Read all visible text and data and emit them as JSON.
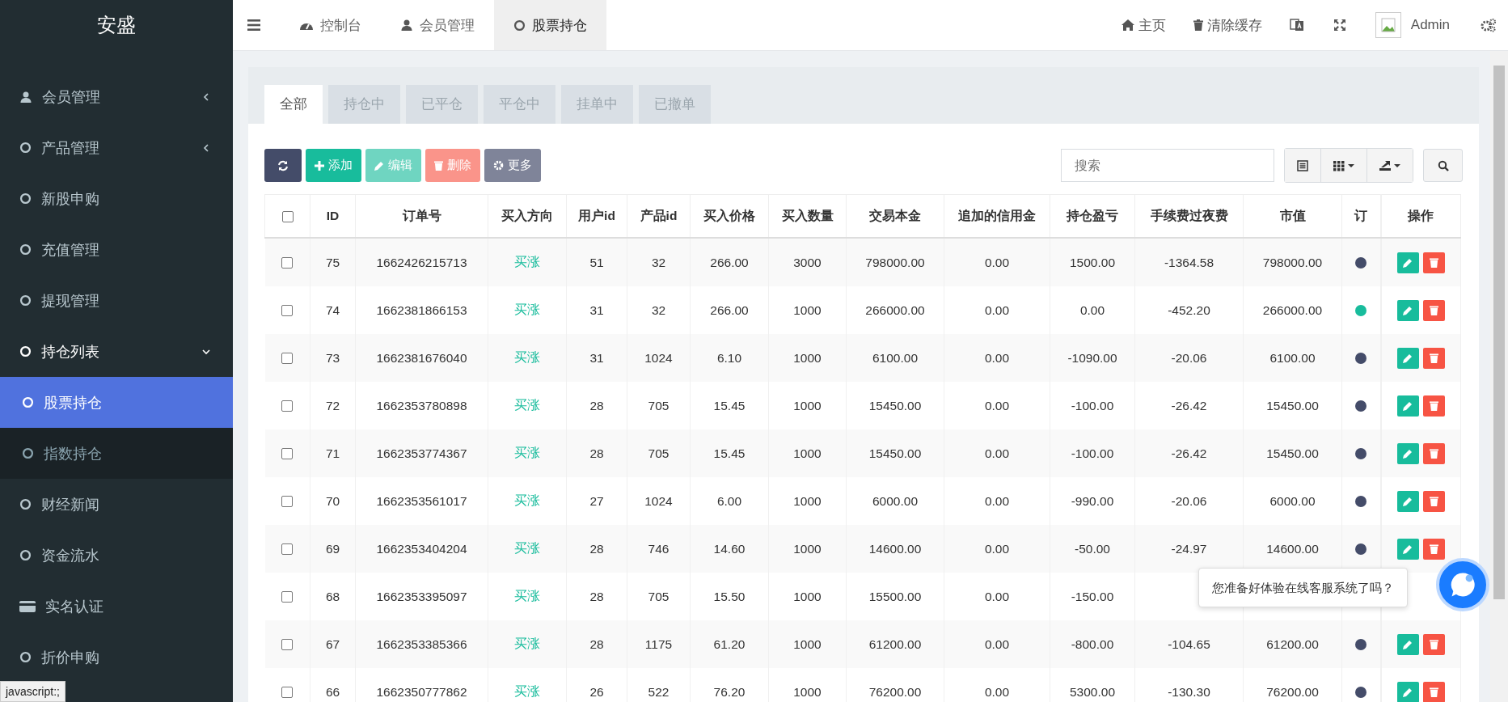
{
  "brand": "安盛",
  "sidebar": {
    "items": [
      {
        "label": "会员管理",
        "kind": "user",
        "expandable": true,
        "expanded": false,
        "selected": false
      },
      {
        "label": "产品管理",
        "kind": "circle",
        "expandable": true,
        "expanded": false,
        "selected": false
      },
      {
        "label": "新股申购",
        "kind": "circle",
        "expandable": false,
        "expanded": false,
        "selected": false
      },
      {
        "label": "充值管理",
        "kind": "circle",
        "expandable": false,
        "expanded": false,
        "selected": false
      },
      {
        "label": "提现管理",
        "kind": "circle",
        "expandable": false,
        "expanded": false,
        "selected": false
      },
      {
        "label": "持仓列表",
        "kind": "circle",
        "expandable": true,
        "expanded": true,
        "selected": false,
        "children": [
          {
            "label": "股票持仓",
            "kind": "circle",
            "selected": true
          },
          {
            "label": "指数持仓",
            "kind": "circle",
            "selected": false
          }
        ]
      },
      {
        "label": "财经新闻",
        "kind": "circle",
        "expandable": false,
        "expanded": false,
        "selected": false
      },
      {
        "label": "资金流水",
        "kind": "circle",
        "expandable": false,
        "expanded": false,
        "selected": false
      },
      {
        "label": "实名认证",
        "kind": "card",
        "expandable": false,
        "expanded": false,
        "selected": false
      },
      {
        "label": "折价申购",
        "kind": "circle",
        "expandable": false,
        "expanded": false,
        "selected": false
      }
    ]
  },
  "topbar": {
    "tabs": [
      {
        "label": "控制台",
        "kind": "dashboard",
        "selected": false
      },
      {
        "label": "会员管理",
        "kind": "user",
        "selected": false
      },
      {
        "label": "股票持仓",
        "kind": "circle",
        "selected": true
      }
    ],
    "links": [
      {
        "label": "主页",
        "kind": "home"
      },
      {
        "label": "清除缓存",
        "kind": "trash"
      }
    ],
    "user": "Admin"
  },
  "filter_tabs": [
    {
      "label": "全部",
      "selected": true
    },
    {
      "label": "持仓中",
      "selected": false
    },
    {
      "label": "已平仓",
      "selected": false
    },
    {
      "label": "平仓中",
      "selected": false
    },
    {
      "label": "挂单中",
      "selected": false
    },
    {
      "label": "已撤单",
      "selected": false
    }
  ],
  "toolbar": {
    "buttons": [
      {
        "kind": "refresh",
        "disabled": false
      },
      {
        "kind": "add",
        "label": "添加",
        "disabled": false
      },
      {
        "kind": "edit",
        "label": "编辑",
        "disabled": true
      },
      {
        "kind": "delete",
        "label": "删除",
        "disabled": true
      },
      {
        "kind": "more",
        "label": "更多",
        "disabled": false
      }
    ],
    "search": {
      "placeholder": "搜索"
    }
  },
  "table": {
    "select_all": {
      "checked": false
    },
    "columns": [
      "ID",
      "订单号",
      "买入方向",
      "用户id",
      "产品id",
      "买入价格",
      "买入数量",
      "交易本金",
      "追加的信用金",
      "持仓盈亏",
      "手续费过夜费",
      "市值",
      "订",
      "操作"
    ],
    "rows": [
      {
        "checked": false,
        "id": "75",
        "order_no": "1662426215713",
        "direction": "买涨",
        "user_id": "51",
        "product_id": "32",
        "price": "266.00",
        "quantity": "3000",
        "principal": "798000.00",
        "credit": "0.00",
        "profit": "1500.00",
        "fees": "-1364.58",
        "market_value": "798000.00",
        "color": "#444c69",
        "actions": true
      },
      {
        "checked": false,
        "id": "74",
        "order_no": "1662381866153",
        "direction": "买涨",
        "user_id": "31",
        "product_id": "32",
        "price": "266.00",
        "quantity": "1000",
        "principal": "266000.00",
        "credit": "0.00",
        "profit": "0.00",
        "fees": "-452.20",
        "market_value": "266000.00",
        "color": "#18bc9c",
        "actions": true
      },
      {
        "checked": false,
        "id": "73",
        "order_no": "1662381676040",
        "direction": "买涨",
        "user_id": "31",
        "product_id": "1024",
        "price": "6.10",
        "quantity": "1000",
        "principal": "6100.00",
        "credit": "0.00",
        "profit": "-1090.00",
        "fees": "-20.06",
        "market_value": "6100.00",
        "color": "#444c69",
        "actions": true
      },
      {
        "checked": false,
        "id": "72",
        "order_no": "1662353780898",
        "direction": "买涨",
        "user_id": "28",
        "product_id": "705",
        "price": "15.45",
        "quantity": "1000",
        "principal": "15450.00",
        "credit": "0.00",
        "profit": "-100.00",
        "fees": "-26.42",
        "market_value": "15450.00",
        "color": "#444c69",
        "actions": true
      },
      {
        "checked": false,
        "id": "71",
        "order_no": "1662353774367",
        "direction": "买涨",
        "user_id": "28",
        "product_id": "705",
        "price": "15.45",
        "quantity": "1000",
        "principal": "15450.00",
        "credit": "0.00",
        "profit": "-100.00",
        "fees": "-26.42",
        "market_value": "15450.00",
        "color": "#444c69",
        "actions": true
      },
      {
        "checked": false,
        "id": "70",
        "order_no": "1662353561017",
        "direction": "买涨",
        "user_id": "27",
        "product_id": "1024",
        "price": "6.00",
        "quantity": "1000",
        "principal": "6000.00",
        "credit": "0.00",
        "profit": "-990.00",
        "fees": "-20.06",
        "market_value": "6000.00",
        "color": "#444c69",
        "actions": true
      },
      {
        "checked": false,
        "id": "69",
        "order_no": "1662353404204",
        "direction": "买涨",
        "user_id": "28",
        "product_id": "746",
        "price": "14.60",
        "quantity": "1000",
        "principal": "14600.00",
        "credit": "0.00",
        "profit": "-50.00",
        "fees": "-24.97",
        "market_value": "14600.00",
        "color": "#444c69",
        "actions": true
      },
      {
        "checked": false,
        "id": "68",
        "order_no": "1662353395097",
        "direction": "买涨",
        "user_id": "28",
        "product_id": "705",
        "price": "15.50",
        "quantity": "1000",
        "principal": "15500.00",
        "credit": "0.00",
        "profit": "-150.00",
        "actions": false
      },
      {
        "checked": false,
        "id": "67",
        "order_no": "1662353385366",
        "direction": "买涨",
        "user_id": "28",
        "product_id": "1175",
        "price": "61.20",
        "quantity": "1000",
        "principal": "61200.00",
        "credit": "0.00",
        "profit": "-800.00",
        "fees": "-104.65",
        "market_value": "61200.00",
        "color": "#444c69",
        "actions": true
      },
      {
        "checked": false,
        "id": "66",
        "order_no": "1662350777862",
        "direction": "买涨",
        "user_id": "26",
        "product_id": "522",
        "price": "76.20",
        "quantity": "1000",
        "principal": "76200.00",
        "credit": "0.00",
        "profit": "5300.00",
        "fees": "-130.30",
        "market_value": "76200.00",
        "color": "#444c69",
        "actions": true
      }
    ]
  },
  "chat": {
    "prompt": "您准备好体验在线客服系统了吗？"
  },
  "status_link": "javascript:;"
}
